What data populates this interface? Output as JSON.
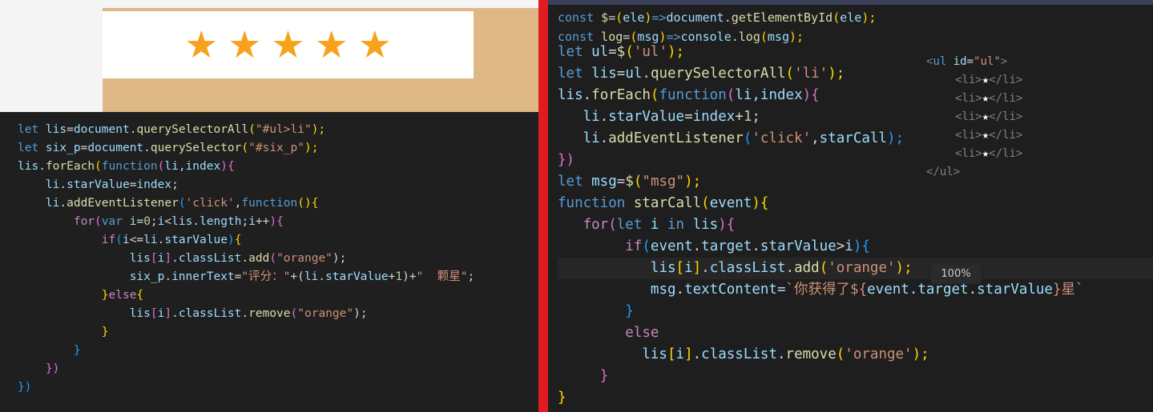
{
  "rating": {
    "stars": [
      "★",
      "★",
      "★",
      "★",
      "★"
    ],
    "star_color": "#f7a21b"
  },
  "left_code": {
    "l1": [
      "let",
      " lis",
      "=",
      "document",
      ".",
      "querySelectorAll",
      "(",
      "\"#ul>li\"",
      ");"
    ],
    "l2": [
      "let",
      " six_p",
      "=",
      "document",
      ".",
      "querySelector",
      "(",
      "\"#six_p\"",
      ");"
    ],
    "l3": [
      "lis",
      ".",
      "forEach",
      "(",
      "function",
      "(",
      "li,index",
      ")",
      "{"
    ],
    "l4": [
      "    ",
      "li",
      ".",
      "starValue",
      "=",
      "index",
      ";"
    ],
    "l5": [
      "    ",
      "li",
      ".",
      "addEventListener",
      "(",
      "'click'",
      ",",
      "function",
      "()",
      "{"
    ],
    "l6": [
      "        ",
      "for",
      "(",
      "var",
      " i",
      "=",
      "0",
      ";",
      "i",
      "<",
      "lis",
      ".",
      "length",
      ";",
      "i",
      "++",
      ")",
      "{"
    ],
    "l7": [
      "            ",
      "if",
      "(",
      "i",
      "<=",
      "li",
      ".",
      "starValue",
      ")",
      "{"
    ],
    "l8": [
      "                ",
      "lis",
      "[",
      "i",
      "]",
      ".",
      "classList",
      ".",
      "add",
      "(",
      "\"orange\"",
      ");"
    ],
    "l9": [
      "                ",
      "six_p",
      ".",
      "innerText",
      "=",
      "\"评分：\"",
      "+(",
      "li",
      ".",
      "starValue",
      "+",
      "1",
      ")+",
      "\"  颗星\"",
      ";"
    ],
    "l10": [
      "            ",
      "}",
      "else",
      "{"
    ],
    "l11": [
      "                ",
      "lis",
      "[",
      "i",
      "]",
      ".",
      "classList",
      ".",
      "remove",
      "(",
      "\"orange\"",
      ");"
    ],
    "l12": [
      "            ",
      "}"
    ],
    "l13": [
      "        ",
      "}"
    ],
    "l14": [
      "    ",
      "})"
    ],
    "l15": [
      "})"
    ]
  },
  "right_code": {
    "t1": [
      "const",
      " $",
      "=",
      "(",
      "ele",
      ")",
      "=>",
      "document",
      ".",
      "getElementById",
      "(",
      "ele",
      ");"
    ],
    "t2": [
      "const",
      " log",
      "=",
      "(",
      "msg",
      ")",
      "=>",
      "console",
      ".",
      "log",
      "(",
      "msg",
      ");"
    ],
    "b1": [
      "let",
      " ul",
      "=",
      "$",
      "(",
      "'ul'",
      ");"
    ],
    "b2": [
      "let",
      " lis",
      "=",
      "ul",
      ".",
      "querySelectorAll",
      "(",
      "'li'",
      ");"
    ],
    "b3": [
      "lis",
      ".",
      "forEach",
      "(",
      "function",
      "(",
      "li,index",
      ")",
      "{"
    ],
    "b4": [
      "   ",
      "li",
      ".",
      "starValue",
      "=",
      "index",
      "+",
      "1",
      ";"
    ],
    "b5": [
      "   ",
      "li",
      ".",
      "addEventListener",
      "(",
      "'click'",
      ",",
      "starCall",
      ");"
    ],
    "b6": [
      "})"
    ],
    "b7": [
      "let",
      " msg",
      "=",
      "$",
      "(",
      "\"msg\"",
      ");"
    ],
    "b8": [
      "function",
      " ",
      "starCall",
      "(",
      "event",
      ")",
      "{"
    ],
    "b9": [
      "   ",
      "for",
      "(",
      "let",
      " i ",
      "in",
      " lis",
      ")",
      "{"
    ],
    "b10": [
      "        ",
      "if",
      "(",
      "event",
      ".",
      "target",
      ".",
      "starValue",
      ">",
      "i",
      ")",
      "{"
    ],
    "b11": [
      "           ",
      "lis",
      "[",
      "i",
      "]",
      ".",
      "classList",
      ".",
      "add",
      "(",
      "'orange'",
      ");"
    ],
    "b12": [
      "           ",
      "msg",
      ".",
      "textContent",
      "=",
      "`你获得了${",
      "event",
      ".",
      "target",
      ".",
      "starValue",
      "}星`"
    ],
    "b13": [
      "        ",
      "}"
    ],
    "b14": [
      "        ",
      "else"
    ],
    "b15": [
      "          ",
      "lis",
      "[",
      "i",
      "]",
      ".",
      "classList",
      ".",
      "remove",
      "(",
      "'orange'",
      ");"
    ],
    "b16": [
      "     ",
      "}"
    ],
    "b17": [
      "}"
    ]
  },
  "html_snippet": {
    "open_lt": "<",
    "open_tag": "ul",
    "attr": " id",
    "eq": "=",
    "attr_val": "\"ul\"",
    "open_gt": ">",
    "li_open": "<li>",
    "li_star": "★",
    "li_close": "</li>",
    "close": "</ul>"
  },
  "zoom_label": "100%"
}
